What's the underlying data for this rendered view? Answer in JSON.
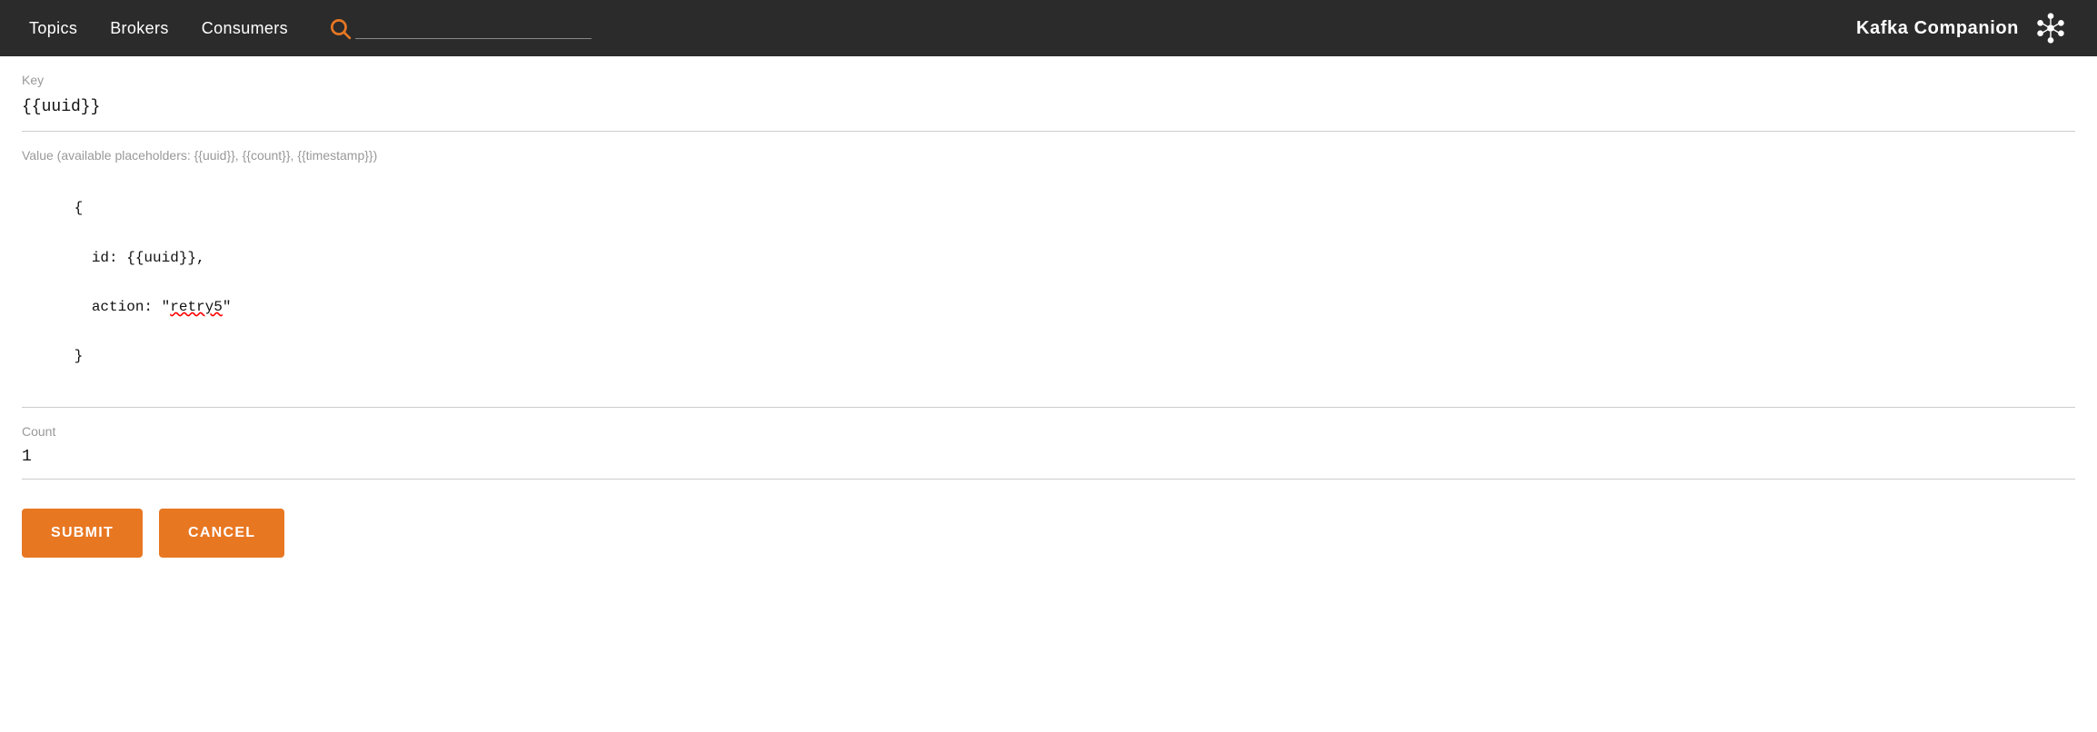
{
  "header": {
    "nav": {
      "topics_label": "Topics",
      "brokers_label": "Brokers",
      "consumers_label": "Consumers"
    },
    "search": {
      "placeholder": ""
    },
    "brand": {
      "name": "Kafka Companion"
    }
  },
  "form": {
    "key_label": "Key",
    "key_value": "{{uuid}}",
    "value_label": "Value (available placeholders: {{uuid}}, {{count}}, {{timestamp}})",
    "value_line1": "{",
    "value_line2": "  id: {{uuid}},",
    "value_line3": "  action: \"retry5\"",
    "value_line4": "}",
    "count_label": "Count",
    "count_value": "1",
    "submit_label": "SUBMIT",
    "cancel_label": "CANCEL"
  },
  "colors": {
    "orange": "#e87722",
    "nav_bg": "#2b2b2b"
  }
}
